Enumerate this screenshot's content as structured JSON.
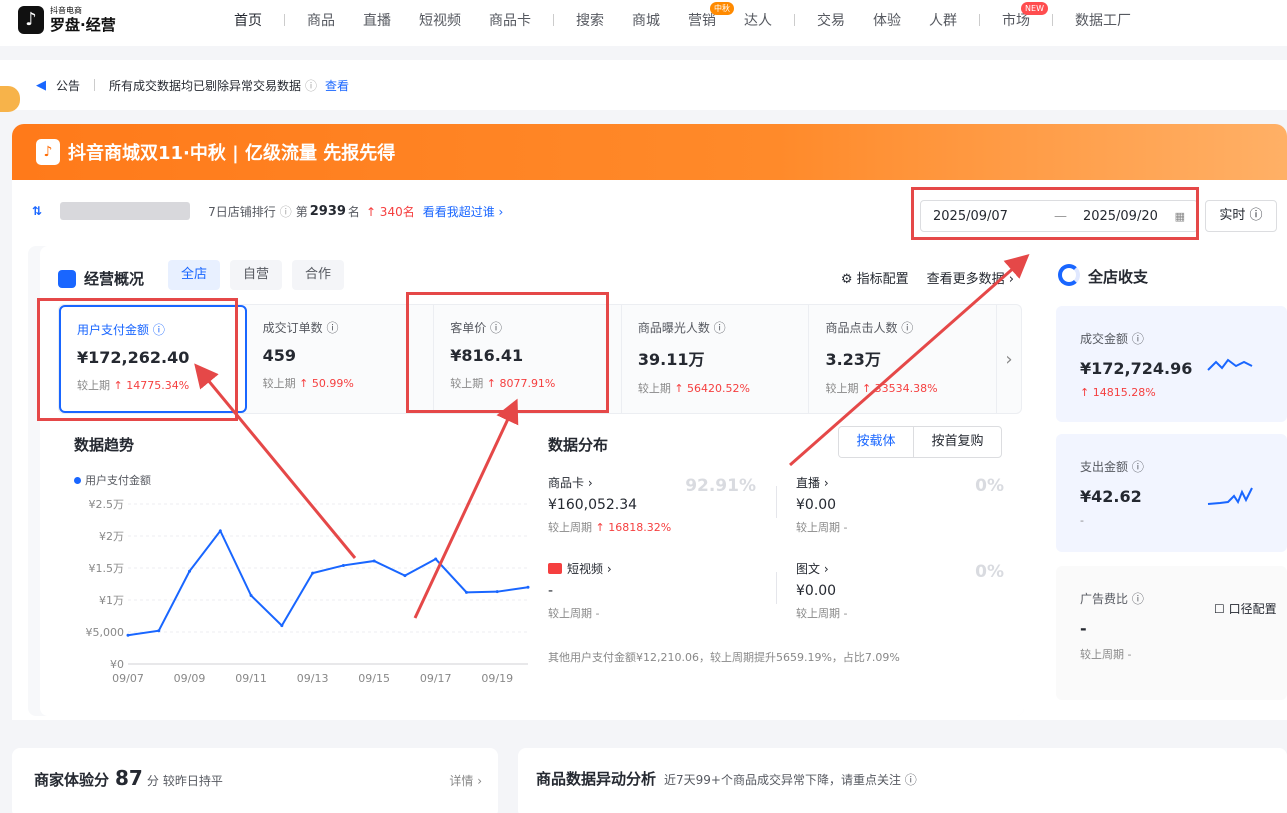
{
  "brand": {
    "sub": "抖音电商",
    "name": "罗盘·经营"
  },
  "nav": [
    "首页",
    "商品",
    "直播",
    "短视频",
    "商品卡",
    "搜索",
    "商城",
    "营销",
    "达人",
    "交易",
    "体验",
    "人群",
    "市场",
    "数据工厂"
  ],
  "nav_tags": {
    "yingxiao": "中秋",
    "shichang": "NEW"
  },
  "notice": {
    "label": "公告",
    "text": "所有成交数据均已剔除异常交易数据",
    "link": "查看"
  },
  "banner": {
    "text": "抖音商城双11·中秋 | 亿级流量 先报先得"
  },
  "shop": {
    "rank_label": "7日店铺排行",
    "rank_prefix": "第",
    "rank": "2939",
    "rank_suffix": "名",
    "rank_up": "↑ 340名",
    "link": "看看我超过谁 ›"
  },
  "date": {
    "start": "2025/09/07",
    "end": "2025/09/20",
    "realtime": "实时 ⓘ"
  },
  "overview": {
    "title": "经营概况",
    "tabs": [
      "全店",
      "自营",
      "合作"
    ],
    "config": "⚙ 指标配置",
    "more": "查看更多数据 ›"
  },
  "metrics": [
    {
      "label": "用户支付金额 ⓘ",
      "value": "¥172,262.40",
      "cmp_label": "较上期",
      "cmp": "↑ 14775.34%"
    },
    {
      "label": "成交订单数 ⓘ",
      "value": "459",
      "cmp_label": "较上期",
      "cmp": "↑ 50.99%"
    },
    {
      "label": "客单价 ⓘ",
      "value": "¥816.41",
      "cmp_label": "较上期",
      "cmp": "↑ 8077.91%"
    },
    {
      "label": "商品曝光人数 ⓘ",
      "value": "39.11万",
      "cmp_label": "较上期",
      "cmp": "↑ 56420.52%"
    },
    {
      "label": "商品点击人数 ⓘ",
      "value": "3.23万",
      "cmp_label": "较上期",
      "cmp": "↑ 33534.38%"
    }
  ],
  "trend": {
    "title": "数据趋势",
    "legend": "用户支付金额"
  },
  "chart_data": {
    "type": "line",
    "series": [
      {
        "name": "用户支付金额",
        "values": [
          4500,
          5200,
          14500,
          20800,
          10700,
          6000,
          14200,
          15400,
          16100,
          13800,
          16400,
          11200,
          11300,
          12000
        ]
      }
    ],
    "x": [
      "09/07",
      "09/08",
      "09/09",
      "09/10",
      "09/11",
      "09/12",
      "09/13",
      "09/14",
      "09/15",
      "09/16",
      "09/17",
      "09/18",
      "09/19",
      "09/20"
    ],
    "x_tick_labels": [
      "09/07",
      "09/09",
      "09/11",
      "09/13",
      "09/15",
      "09/17",
      "09/19"
    ],
    "y_tick_labels": [
      "¥0",
      "¥5,000",
      "¥1万",
      "¥1.5万",
      "¥2万",
      "¥2.5万"
    ],
    "ylim": [
      0,
      25000
    ],
    "color": "#1966ff"
  },
  "dist": {
    "title": "数据分布",
    "seg": [
      "按载体",
      "按首复购"
    ],
    "channels": [
      {
        "name": "商品卡 ›",
        "value": "¥160,052.34",
        "cmp_label": "较上周期",
        "cmp": "↑ 16818.32%",
        "pct": "92.91%"
      },
      {
        "name": "直播 ›",
        "value": "¥0.00",
        "cmp_label": "较上周期 -",
        "cmp": "",
        "pct": "0%"
      },
      {
        "name": "短视频 ›",
        "value": "-",
        "cmp_label": "较上周期 -",
        "cmp": "",
        "pct": ""
      },
      {
        "name": "图文 ›",
        "value": "¥0.00",
        "cmp_label": "较上周期 -",
        "cmp": "",
        "pct": "0%"
      }
    ],
    "footer": "其他用户支付金额¥12,210.06，较上周期提升5659.19%，占比7.09%"
  },
  "side": {
    "title": "全店收支",
    "cards": [
      {
        "label": "成交金额 ⓘ",
        "value": "¥172,724.96",
        "cmp": "↑ 14815.28%"
      },
      {
        "label": "支出金额 ⓘ",
        "value": "¥42.62",
        "cmp": "-"
      },
      {
        "label": "广告费比 ⓘ",
        "value": "-",
        "cmp": "较上周期 -",
        "action": "☐ 口径配置"
      }
    ]
  },
  "exp": {
    "title": "商家体验分",
    "score": "87",
    "unit": "分",
    "cmp": "较昨日持平",
    "detail": "详情 ›"
  },
  "anomaly": {
    "title": "商品数据异动分析",
    "desc": "近7天99+个商品成交异常下降，请重点关注 ⓘ"
  }
}
